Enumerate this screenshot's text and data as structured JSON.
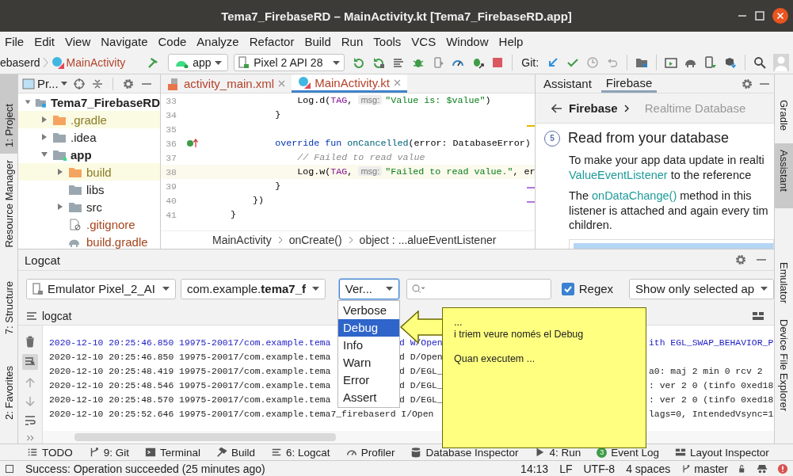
{
  "window": {
    "title": "Tema7_FirebaseRD – MainActivity.kt [Tema7_FirebaseRD.app]"
  },
  "menu": [
    "File",
    "Edit",
    "View",
    "Navigate",
    "Code",
    "Analyze",
    "Refactor",
    "Build",
    "Run",
    "Tools",
    "VCS",
    "Window",
    "Help"
  ],
  "toolbar": {
    "project_crumb": "ebaserd",
    "file_crumb": "MainActivity",
    "config": "app",
    "device": "Pixel 2 API 28",
    "git_label": "Git:"
  },
  "left_strip": [
    {
      "label": "1: Project",
      "selected": true
    },
    {
      "label": "Resource Manager",
      "selected": false
    },
    {
      "label": "7: Structure",
      "selected": false
    },
    {
      "label": "2: Favorites",
      "selected": false
    }
  ],
  "right_strip": [
    {
      "label": "Gradle",
      "selected": false
    },
    {
      "label": "Assistant",
      "selected": true
    },
    {
      "label": "Emulator",
      "selected": false
    },
    {
      "label": "Device File Explorer",
      "selected": false
    }
  ],
  "project": {
    "title": "Pr...",
    "tree": [
      {
        "label": "Tema7_FirebaseRD",
        "kind": "project",
        "expanded": true,
        "children": [
          {
            "label": ".gradle",
            "kind": "excluded",
            "expanded": false
          },
          {
            "label": ".idea",
            "kind": "folder",
            "expanded": false
          },
          {
            "label": "app",
            "kind": "module",
            "expanded": true,
            "children": [
              {
                "label": "build",
                "kind": "excluded",
                "expanded": false
              },
              {
                "label": "libs",
                "kind": "folder"
              },
              {
                "label": "src",
                "kind": "folder",
                "expanded": false
              },
              {
                "label": ".gitignore",
                "kind": "file"
              },
              {
                "label": "build.gradle",
                "kind": "gradle"
              }
            ]
          }
        ]
      }
    ]
  },
  "editor": {
    "tabs": [
      {
        "label": "activity_main.xml",
        "kind": "xml",
        "selected": false
      },
      {
        "label": "MainActivity.kt",
        "kind": "kotlin",
        "selected": true
      }
    ],
    "lines": [
      {
        "number": "33",
        "caret": false,
        "marker": false,
        "tokens": [
          {
            "kind": "plain",
            "text": "                Log.d("
          },
          {
            "kind": "field",
            "text": "TAG"
          },
          {
            "kind": "plain",
            "text": ", "
          },
          {
            "kind": "hint",
            "text": "msg:"
          },
          {
            "kind": "string",
            "text": "\"Value is: $value\""
          },
          {
            "kind": "plain",
            "text": ")"
          }
        ]
      },
      {
        "number": "34",
        "caret": false,
        "marker": false,
        "tokens": [
          {
            "kind": "plain",
            "text": "            }"
          }
        ]
      },
      {
        "number": "35",
        "caret": false,
        "marker": false
      },
      {
        "number": "36",
        "caret": false,
        "marker": true,
        "tokens": [
          {
            "kind": "keyword",
            "text": "            override fun "
          },
          {
            "kind": "method",
            "text": "onCancelled"
          },
          {
            "kind": "plain",
            "text": "(error: DatabaseError)"
          }
        ]
      },
      {
        "number": "37",
        "caret": false,
        "marker": false,
        "tokens": [
          {
            "kind": "comment",
            "text": "                // Failed to read value"
          }
        ]
      },
      {
        "number": "38",
        "caret": true,
        "marker": false,
        "tokens": [
          {
            "kind": "plain",
            "text": "                Log.w("
          },
          {
            "kind": "field",
            "text": "TAG"
          },
          {
            "kind": "plain",
            "text": ", "
          },
          {
            "kind": "hint",
            "text": "msg:"
          },
          {
            "kind": "string",
            "text": "\"Failed to read value.\""
          },
          {
            "kind": "plain",
            "text": ", er"
          }
        ]
      },
      {
        "number": "39",
        "caret": false,
        "marker": false,
        "tokens": [
          {
            "kind": "plain",
            "text": "            }"
          }
        ]
      },
      {
        "number": "40",
        "caret": false,
        "marker": false,
        "tokens": [
          {
            "kind": "plain",
            "text": "        })"
          }
        ]
      },
      {
        "number": "41",
        "caret": false,
        "marker": false,
        "tokens": [
          {
            "kind": "plain",
            "text": "    }"
          }
        ]
      }
    ],
    "breadcrumb": [
      "MainActivity",
      "onCreate()",
      "object : ...alueEventListener"
    ]
  },
  "assistant": {
    "tabs": [
      {
        "label": "Assistant",
        "selected": false
      },
      {
        "label": "Firebase",
        "selected": true
      }
    ],
    "back": "Firebase",
    "crumb": "Realtime Database",
    "step": "5",
    "heading": "Read from your database",
    "paragraphs": [
      [
        [
          {
            "text": "To make your app data update in realti",
            "link": false
          }
        ],
        [
          {
            "text": "ValueEventListener",
            "link": true
          },
          {
            "text": " to the reference",
            "link": false
          }
        ]
      ],
      [
        [
          {
            "text": "The ",
            "link": false
          },
          {
            "text": "onDataChange()",
            "link": true
          },
          {
            "text": " method in this",
            "link": false
          }
        ],
        [
          {
            "text": "listener is attached and again every tim",
            "link": false
          }
        ],
        [
          {
            "text": "children.",
            "link": false
          }
        ]
      ]
    ]
  },
  "logcat": {
    "title": "Logcat",
    "device": "Emulator Pixel_2_AI",
    "package": "com.example.**tema7_f**",
    "level": "Ver...",
    "regex": {
      "label": "Regex",
      "checked": true
    },
    "filter": "Show only selected ap",
    "tab": "logcat",
    "levels": [
      {
        "label": "Verbose",
        "selected": false
      },
      {
        "label": "Debug",
        "selected": true
      },
      {
        "label": "Info",
        "selected": false
      },
      {
        "label": "Warn",
        "selected": false
      },
      {
        "label": "Error",
        "selected": false
      },
      {
        "label": "Assert",
        "selected": false
      }
    ],
    "rows": [
      {
        "color": "#1a1ac4",
        "left": "2020-12-10 20:25:46.850 19975-20017/com.example.tema",
        "middle": "d W/Open",
        "right": "ith EGL_SWAP_BEHAVIOR_P"
      },
      {
        "color": "#222222",
        "left": "2020-12-10 20:25:46.850 19975-20017/com.example.tema",
        "middle": "d D/Open"
      },
      {
        "color": "#222222",
        "left": "2020-12-10 20:25:48.419 19975-20017/com.example.tema",
        "middle": "d D/EGL_",
        "right": "a0: maj 2 min 0 rcv 2"
      },
      {
        "color": "#222222",
        "left": "2020-12-10 20:25:48.546 19975-20017/com.example.tema",
        "middle": "d D/EGL_",
        "right": ": ver 2 0 (tinfo 0xed18"
      },
      {
        "color": "#222222",
        "left": "2020-12-10 20:25:48.570 19975-20017/com.example.tema",
        "middle": "d D/EGL_",
        "right": ": ver 2 0 (tinfo 0xed18"
      },
      {
        "color": "#222222",
        "left": "2020-12-10 20:25:52.646 19975-20017/com.example.tema7_firebaserd I/Open",
        "right": "lags=0, IntendedVsync=1"
      }
    ]
  },
  "callout": {
    "paragraphs": [
      [
        "...",
        "i triem veure només el Debug"
      ],
      [
        "Quan executem ..."
      ]
    ]
  },
  "tool_windows": [
    {
      "label": "TODO",
      "kind": "todo"
    },
    {
      "label": "9: Git",
      "kind": "git"
    },
    {
      "label": "Terminal",
      "kind": "terminal"
    },
    {
      "label": "Build",
      "kind": "build"
    },
    {
      "label": "6: Logcat",
      "kind": "logcat"
    },
    {
      "label": "Profiler",
      "kind": "profiler"
    },
    {
      "label": "Database Inspector",
      "kind": "database"
    },
    {
      "label": "4: Run",
      "kind": "run"
    },
    {
      "label": "Event Log",
      "kind": "events",
      "badge": "3"
    },
    {
      "label": "Layout Inspector",
      "kind": "layout"
    }
  ],
  "status": {
    "message": "Success: Operation succeeded (25 minutes ago)",
    "items": [
      "14:13",
      "LF",
      "UTF-8",
      "4 spaces"
    ],
    "branch": "master"
  }
}
